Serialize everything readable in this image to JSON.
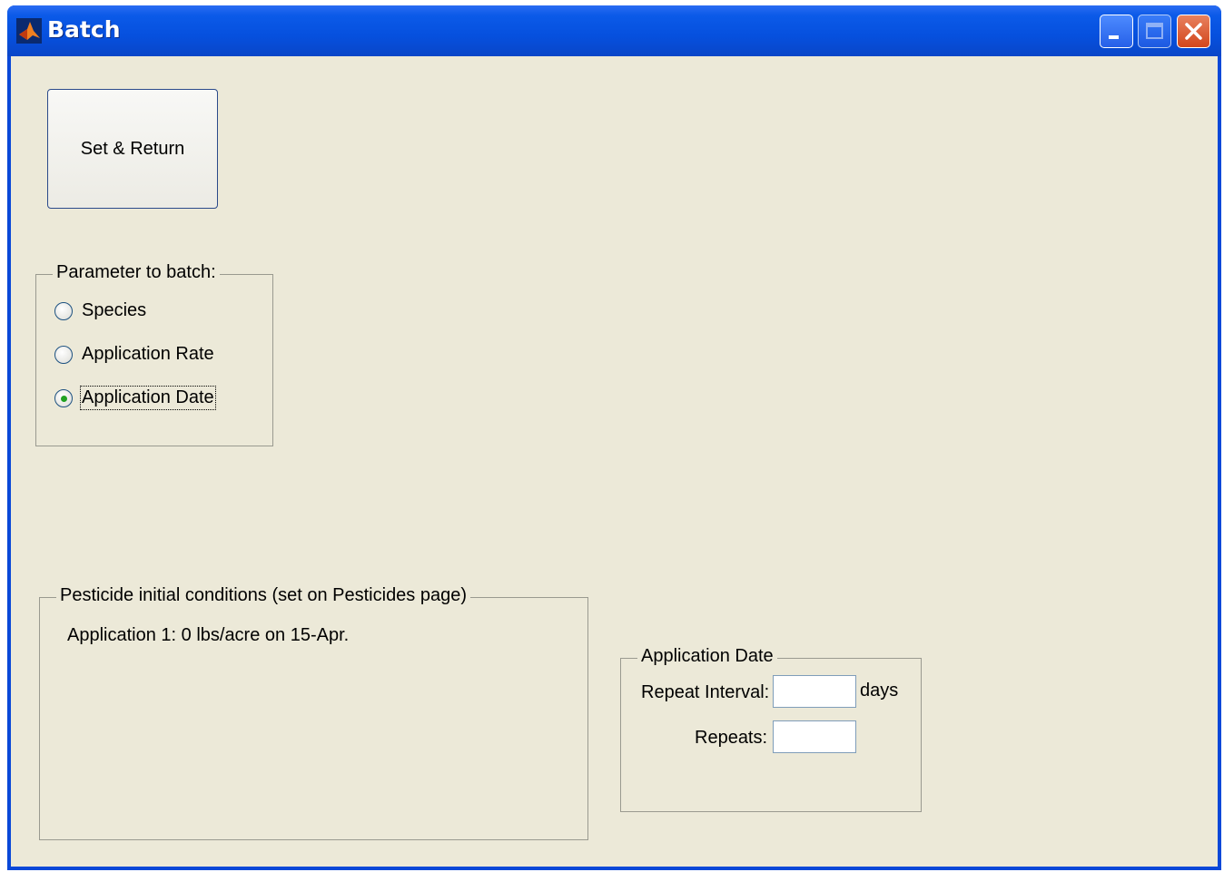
{
  "window": {
    "title": "Batch",
    "icon": "matlab-icon",
    "controls": {
      "minimize": "minimize-icon",
      "maximize": "maximize-icon",
      "close": "close-icon"
    }
  },
  "set_return_button": {
    "label": "Set & Return"
  },
  "parameter_group": {
    "label": "Parameter to batch:",
    "options": [
      {
        "label": "Species",
        "checked": false
      },
      {
        "label": "Application Rate",
        "checked": false
      },
      {
        "label": "Application Date",
        "checked": true
      }
    ]
  },
  "pesticide_group": {
    "label": "Pesticide initial conditions (set on Pesticides page)",
    "lines": [
      "Application 1: 0 lbs/acre on 15-Apr."
    ]
  },
  "application_date_group": {
    "label": "Application Date",
    "repeat_interval_label": "Repeat Interval:",
    "repeat_interval_value": "",
    "repeat_interval_unit": "days",
    "repeats_label": "Repeats:",
    "repeats_value": ""
  },
  "colors": {
    "titlebar": "#0650de",
    "client_bg": "#ece9d8",
    "close_button": "#d2461c"
  }
}
